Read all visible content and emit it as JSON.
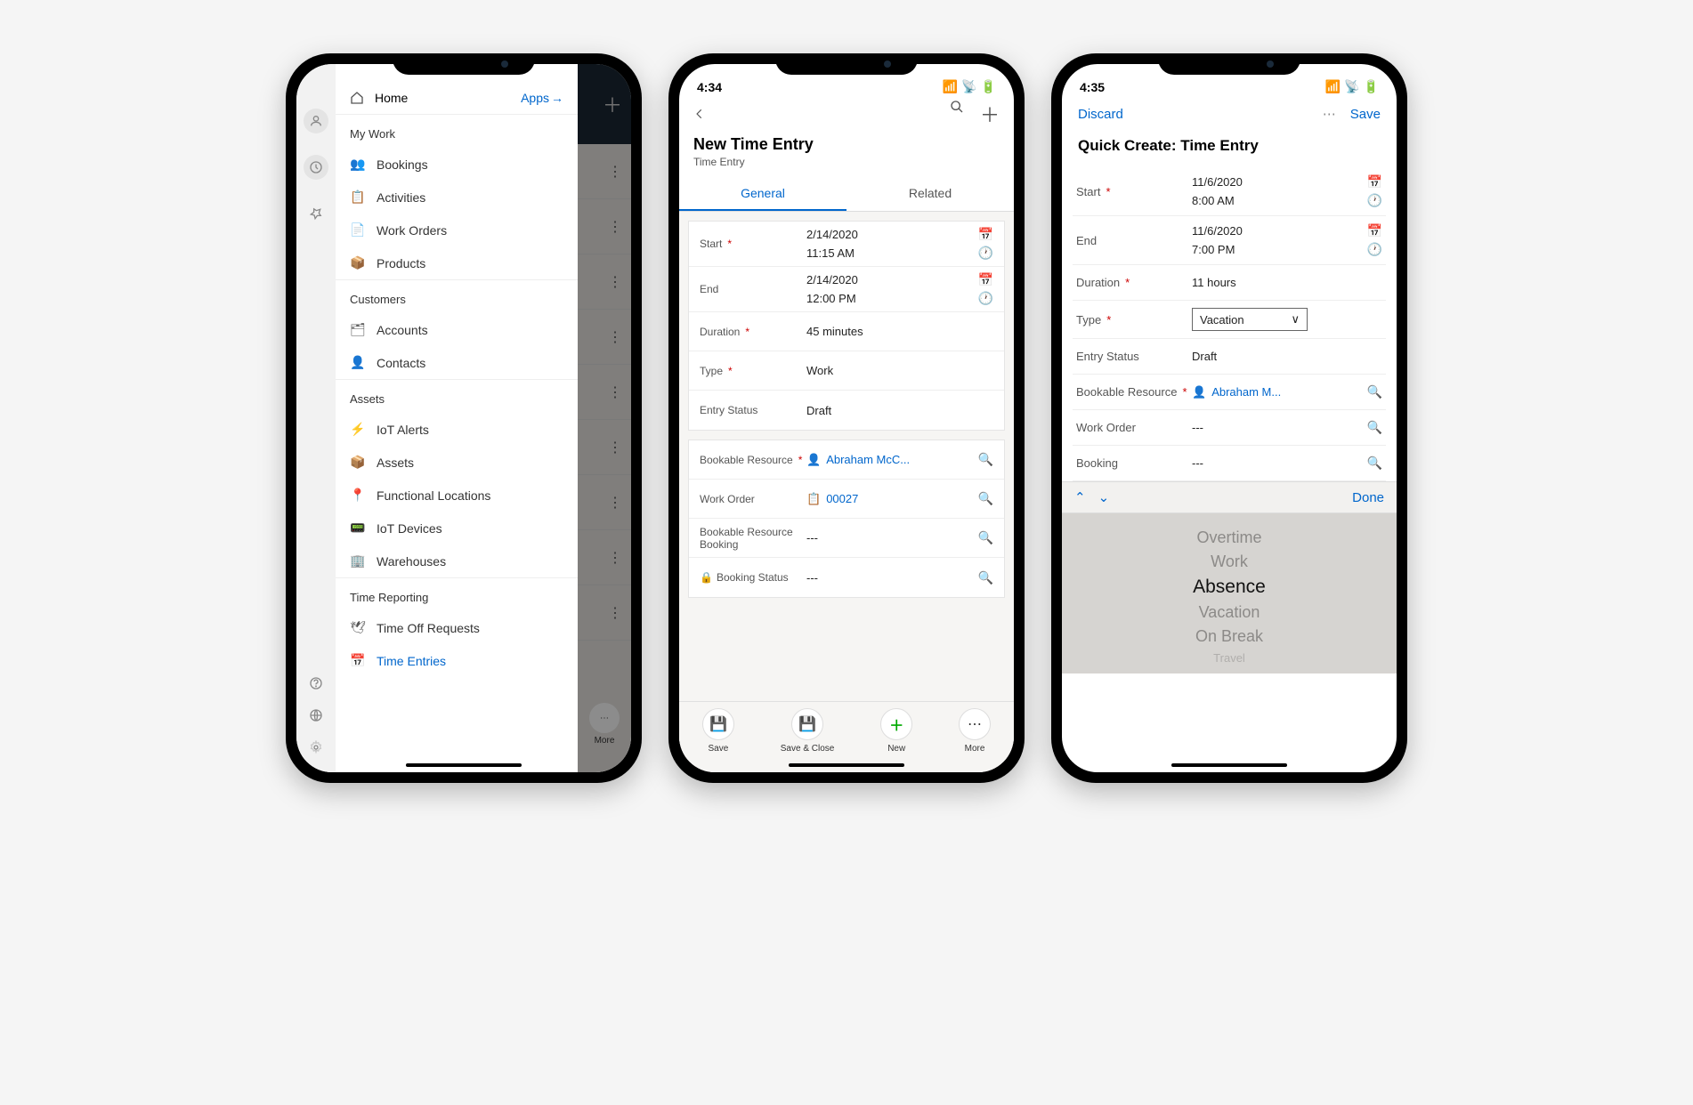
{
  "phone1": {
    "home_label": "Home",
    "apps_label": "Apps",
    "sections": {
      "mywork": {
        "title": "My Work",
        "items": [
          "Bookings",
          "Activities",
          "Work Orders",
          "Products"
        ]
      },
      "customers": {
        "title": "Customers",
        "items": [
          "Accounts",
          "Contacts"
        ]
      },
      "assets": {
        "title": "Assets",
        "items": [
          "IoT Alerts",
          "Assets",
          "Functional Locations",
          "IoT Devices",
          "Warehouses"
        ]
      },
      "timereporting": {
        "title": "Time Reporting",
        "items": [
          "Time Off Requests",
          "Time Entries"
        ]
      }
    },
    "bg_more": "More"
  },
  "phone2": {
    "time": "4:34",
    "title": "New Time Entry",
    "subtitle": "Time Entry",
    "tabs": {
      "general": "General",
      "related": "Related"
    },
    "fields": {
      "start_label": "Start",
      "start_date": "2/14/2020",
      "start_time": "11:15 AM",
      "end_label": "End",
      "end_date": "2/14/2020",
      "end_time": "12:00 PM",
      "duration_label": "Duration",
      "duration_value": "45 minutes",
      "type_label": "Type",
      "type_value": "Work",
      "entrystatus_label": "Entry Status",
      "entrystatus_value": "Draft",
      "bookable_label": "Bookable Resource",
      "bookable_value": "Abraham McC...",
      "workorder_label": "Work Order",
      "workorder_value": "00027",
      "brb_label": "Bookable Resource Booking",
      "brb_value": "---",
      "bookingstatus_label": "Booking Status",
      "bookingstatus_value": "---"
    },
    "bottom": {
      "save": "Save",
      "saveclose": "Save & Close",
      "new": "New",
      "more": "More"
    }
  },
  "phone3": {
    "time": "4:35",
    "discard": "Discard",
    "save": "Save",
    "title": "Quick Create: Time Entry",
    "fields": {
      "start_label": "Start",
      "start_date": "11/6/2020",
      "start_time": "8:00 AM",
      "end_label": "End",
      "end_date": "11/6/2020",
      "end_time": "7:00 PM",
      "duration_label": "Duration",
      "duration_value": "11 hours",
      "type_label": "Type",
      "type_value": "Vacation",
      "entrystatus_label": "Entry Status",
      "entrystatus_value": "Draft",
      "bookable_label": "Bookable Resource",
      "bookable_value": "Abraham M...",
      "workorder_label": "Work Order",
      "workorder_value": "---",
      "booking_label": "Booking",
      "booking_value": "---"
    },
    "picker": {
      "done": "Done",
      "options": [
        "Overtime",
        "Work",
        "Absence",
        "Vacation",
        "On Break",
        "Travel"
      ],
      "selected_index": 2
    }
  }
}
